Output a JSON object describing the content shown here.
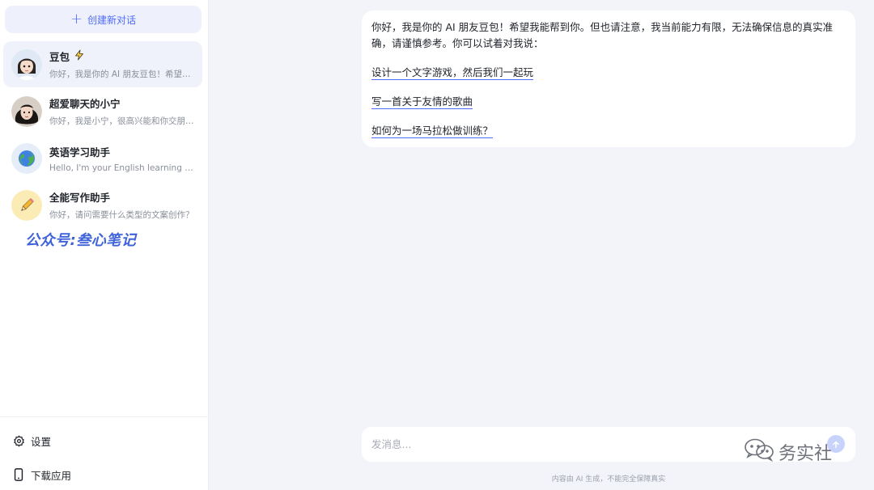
{
  "sidebar": {
    "new_chat_label": "创建新对话",
    "conversations": [
      {
        "title": "豆包",
        "subtitle": "你好，我是你的 AI 朋友豆包！希望我能帮到你。",
        "avatar": "doubao-avatar",
        "badge": "lightning-icon",
        "active": true
      },
      {
        "title": "超爱聊天的小宁",
        "subtitle": "你好，我是小宁，很高兴能和你交朋友。",
        "avatar": "xiaoning-avatar",
        "active": false
      },
      {
        "title": "英语学习助手",
        "subtitle": "Hello, I'm your English learning assistant.",
        "avatar": "globe-icon",
        "active": false
      },
      {
        "title": "全能写作助手",
        "subtitle": "你好，请问需要什么类型的文案创作？",
        "avatar": "pencil-icon",
        "active": false
      }
    ],
    "watermark": "公众号:叁心笔记",
    "settings_label": "设置",
    "download_label": "下载应用"
  },
  "chat": {
    "intro": "你好，我是你的 AI 朋友豆包！希望我能帮到你。但也请注意，我当前能力有限，无法确保信息的真实准确，请谨慎参考。你可以试着对我说：",
    "suggestions": [
      "设计一个文字游戏，然后我们一起玩",
      "写一首关于友情的歌曲",
      "如何为一场马拉松做训练？"
    ]
  },
  "input": {
    "placeholder": "发消息...",
    "value": ""
  },
  "footer": {
    "disclaimer": "内容由 AI 生成，不能完全保障真实",
    "watermark_text": "务实社"
  },
  "colors": {
    "accent": "#4d6bfe",
    "sidebar_bg": "#ffffff",
    "main_bg": "#f3f4f9",
    "watermark_blue": "#3f63d8"
  }
}
